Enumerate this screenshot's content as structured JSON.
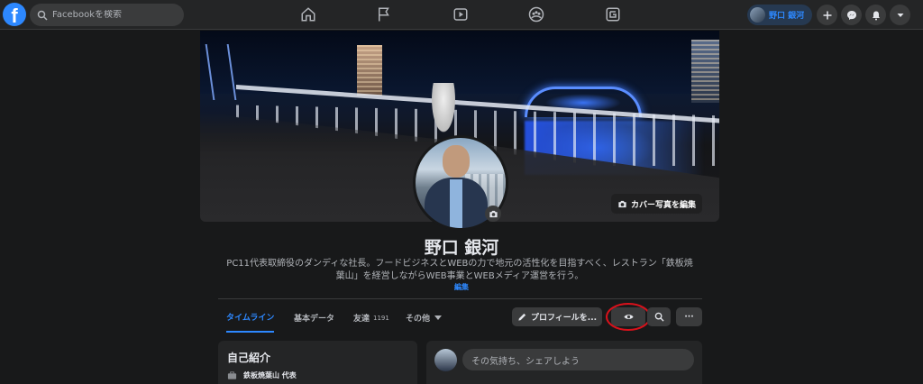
{
  "topbar": {
    "logo": "f",
    "search_placeholder": "Facebookを検索",
    "nav_icons": [
      "home-icon",
      "flag-icon",
      "video-icon",
      "groups-icon",
      "gaming-icon"
    ],
    "user_name": "野口 銀河",
    "right_icons": [
      "plus-icon",
      "messenger-icon",
      "bell-icon",
      "caret-down-icon"
    ]
  },
  "cover": {
    "edit_label": "カバー写真を編集"
  },
  "profile": {
    "name": "野口 銀河",
    "bio": "PC11代表取締役のダンディな社長。フードビジネスとWEBの力で地元の活性化を目指すべく、レストラン「鉄板焼葉山」を経営しながらWEB事業とWEBメディア運営を行う。",
    "bio_edit": "編集"
  },
  "tabs": [
    {
      "label": "タイムライン",
      "count": ""
    },
    {
      "label": "基本データ",
      "count": ""
    },
    {
      "label": "友達",
      "count": "1191"
    },
    {
      "label": "その他",
      "count": ""
    }
  ],
  "actions": {
    "edit_profile": "プロフィールを...",
    "view_as_icon": "eye-icon",
    "search_icon": "search-icon",
    "more": "···"
  },
  "intro": {
    "title": "自己紹介",
    "work": "鉄板焼葉山 代表"
  },
  "composer": {
    "placeholder": "その気持ち、シェアしよう"
  },
  "colors": {
    "accent": "#2d88ff",
    "background": "#18191a",
    "surface": "#242526",
    "highlight_ring": "#d9111b"
  }
}
